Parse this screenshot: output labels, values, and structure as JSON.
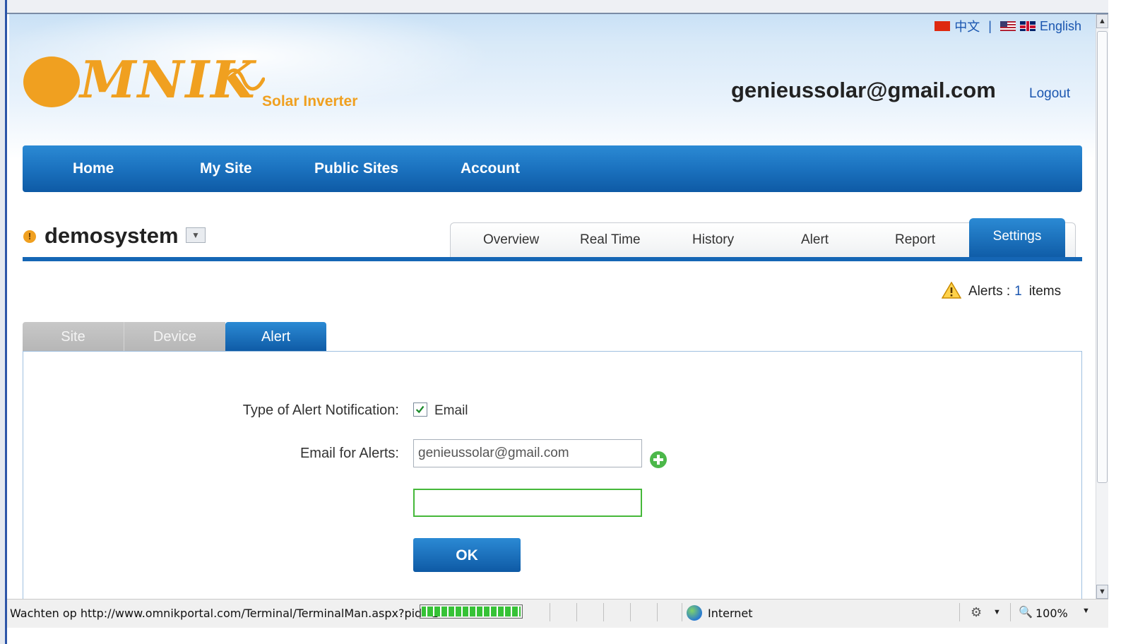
{
  "header": {
    "lang_chinese": "中文",
    "lang_separator": "|",
    "lang_english": "English",
    "logo_text": "MNIK",
    "logo_subtitle": "Solar Inverter",
    "user_email": "genieussolar@gmail.com",
    "logout_label": "Logout"
  },
  "nav": {
    "items": [
      {
        "label": "Home"
      },
      {
        "label": "My Site"
      },
      {
        "label": "Public Sites"
      },
      {
        "label": "Account"
      }
    ]
  },
  "site": {
    "name": "demosystem",
    "warning_glyph": "!"
  },
  "tabs": {
    "items": [
      {
        "label": "Overview"
      },
      {
        "label": "Real Time"
      },
      {
        "label": "History"
      },
      {
        "label": "Alert"
      },
      {
        "label": "Report"
      },
      {
        "label": "Settings"
      }
    ],
    "active": "Settings"
  },
  "alerts_summary": {
    "label": "Alerts :",
    "count": "1",
    "unit": "items"
  },
  "subtabs": {
    "items": [
      {
        "label": "Site"
      },
      {
        "label": "Device"
      },
      {
        "label": "Alert"
      }
    ],
    "active": "Alert"
  },
  "form": {
    "notification_label": "Type of Alert Notification:",
    "email_checkbox_label": "Email",
    "email_checked": true,
    "email_label": "Email for Alerts:",
    "email_value": "genieussolar@gmail.com",
    "email2_value": "",
    "ok_label": "OK"
  },
  "statusbar": {
    "text": "Wachten op http://www.omnikportal.com/Terminal/TerminalMan.aspx?pid=1",
    "zone": "Internet",
    "zoom": "100%"
  },
  "colors": {
    "accent_blue": "#1566b5",
    "brand_orange": "#f0a020",
    "link_blue": "#1a56b0"
  }
}
